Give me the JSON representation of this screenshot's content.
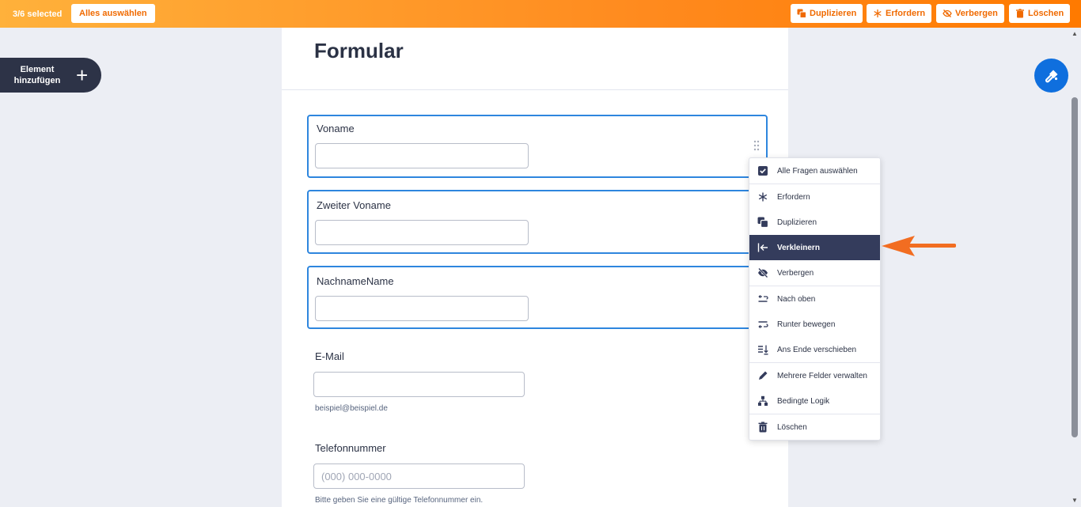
{
  "topbar": {
    "selected_count": "3/6 selected",
    "select_all_label": "Alles auswählen",
    "duplicate_label": "Duplizieren",
    "require_label": "Erfordern",
    "hide_label": "Verbergen",
    "delete_label": "Löschen"
  },
  "sidebar": {
    "add_element_label": "Element hinzufügen",
    "add_icon": "+"
  },
  "form": {
    "title": "Formular",
    "fields": [
      {
        "label": "Voname",
        "value": "",
        "placeholder": "",
        "selected": true
      },
      {
        "label": "Zweiter Voname",
        "value": "",
        "placeholder": "",
        "selected": true
      },
      {
        "label": "NachnameName",
        "value": "",
        "placeholder": "",
        "selected": true
      },
      {
        "label": "E-Mail",
        "value": "",
        "placeholder": "",
        "sublabel": "beispiel@beispiel.de",
        "selected": false
      },
      {
        "label": "Telefonnummer",
        "value": "",
        "placeholder": "(000) 000-0000",
        "sublabel": "Bitte geben Sie eine gültige Telefonnummer ein.",
        "selected": false
      }
    ]
  },
  "context_menu": {
    "items": [
      {
        "label": "Alle Fragen auswählen",
        "icon": "checkbox-icon"
      },
      {
        "label": "Erfordern",
        "icon": "asterisk-icon"
      },
      {
        "label": "Duplizieren",
        "icon": "duplicate-icon"
      },
      {
        "label": "Verkleinern",
        "icon": "shrink-icon",
        "active": true
      },
      {
        "label": "Verbergen",
        "icon": "eye-off-icon"
      },
      {
        "label": "Nach oben",
        "icon": "move-up-icon"
      },
      {
        "label": "Runter bewegen",
        "icon": "move-down-icon"
      },
      {
        "label": "Ans Ende verschieben",
        "icon": "move-to-end-icon"
      },
      {
        "label": "Mehrere Felder verwalten",
        "icon": "pencil-icon"
      },
      {
        "label": "Bedingte Logik",
        "icon": "logic-icon"
      },
      {
        "label": "Löschen",
        "icon": "trash-icon"
      }
    ]
  },
  "colors": {
    "accent_orange": "#ff8a1e",
    "selection_blue": "#2e86de",
    "menu_active": "#343c5c",
    "fab_blue": "#0f6fde"
  }
}
